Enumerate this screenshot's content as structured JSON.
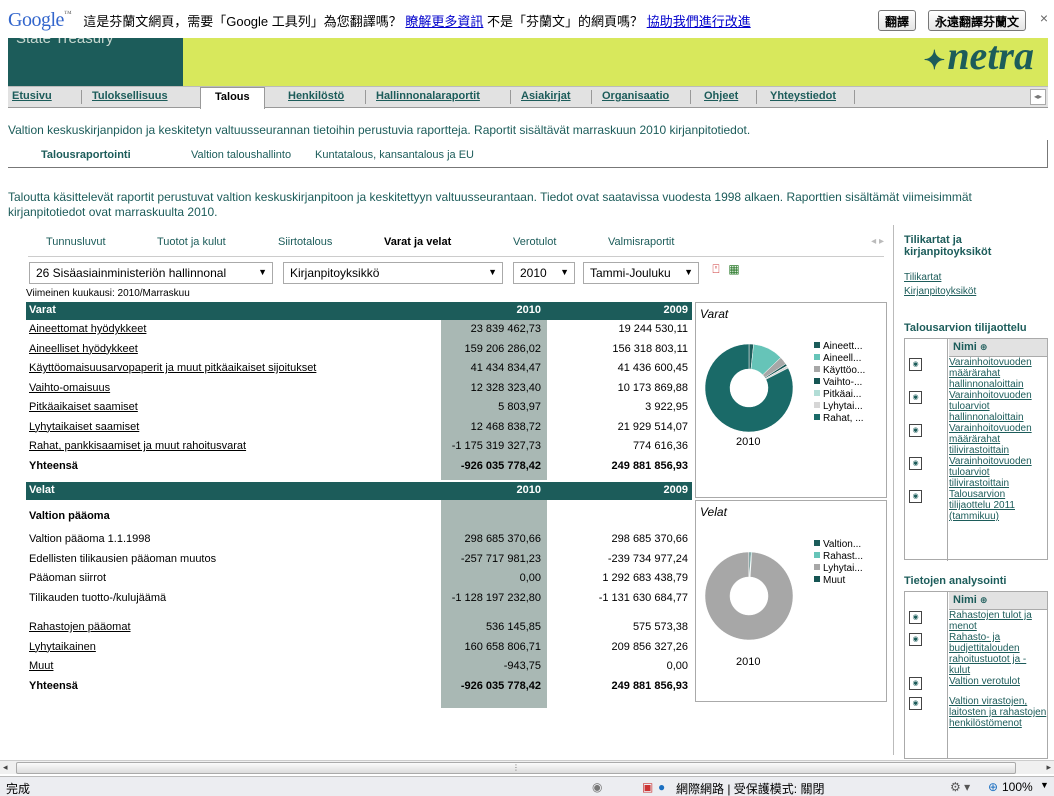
{
  "translate_bar": {
    "logo": "Google",
    "prompt": "這是芬蘭文網頁，需要「Google 工具列」為您翻譯嗎？",
    "learn_more": "瞭解更多資訊",
    "not_finnish": "不是「芬蘭文」的網頁嗎？",
    "help_improve": "協助我們進行改進",
    "translate_btn": "翻譯",
    "always_btn": "永遠翻譯芬蘭文",
    "close": "×"
  },
  "header": {
    "left_text": "State Treasury",
    "brand": "netra"
  },
  "nav": {
    "tabs": [
      "Etusivu",
      "Tuloksellisuus",
      "Talous",
      "Henkilöstö",
      "Hallinnonalaraportit",
      "Asiakirjat",
      "Organisaatio",
      "Ohjeet",
      "Yhteystiedot"
    ],
    "active": "Talous"
  },
  "intro1": "Valtion keskuskirjanpidon ja keskitetyn valtuusseurannan tietoihin perustuvia raportteja. Raportit sisältävät marraskuun 2010 kirjanpitotiedot.",
  "subnav": [
    "Talousraportointi",
    "Valtion taloushallinto",
    "Kuntatalous, kansantalous ja EU"
  ],
  "intro2": "Taloutta käsittelevät raportit perustuvat valtion keskuskirjanpitoon ja keskitettyyn valtuusseurantaan. Tiedot ovat saatavissa vuodesta 1998 alkaen. Raporttien sisältämät viimeisimmät kirjanpitotiedot ovat marraskuulta 2010.",
  "report_tabs": [
    "Tunnusluvut",
    "Tuotot ja kulut",
    "Siirtotalous",
    "Varat ja velat",
    "Verotulot",
    "Valmisraportit"
  ],
  "report_tab_active": "Varat ja velat",
  "filters": {
    "ministry": "26 Sisäasiainministeriön hallinnonal",
    "unit": "Kirjanpitoyksikkö",
    "year": "2010",
    "period": "Tammi-Jouluku"
  },
  "last_month": "Viimeinen kuukausi: 2010/Marraskuu",
  "assets": {
    "header": {
      "label": "Varat",
      "y1": "2010",
      "y2": "2009"
    },
    "rows": [
      {
        "label": "Aineettomat hyödykkeet",
        "v1": "23 839 462,73",
        "v2": "19 244 530,11",
        "link": true
      },
      {
        "label": "Aineelliset hyödykkeet",
        "v1": "159 206 286,02",
        "v2": "156 318 803,11",
        "link": true
      },
      {
        "label": "Käyttöomaisuusarvopaperit ja muut pitkäaikaiset sijoitukset",
        "v1": "41 434 834,47",
        "v2": "41 436 600,45",
        "link": true
      },
      {
        "label": "Vaihto-omaisuus",
        "v1": "12 328 323,40",
        "v2": "10 173 869,88",
        "link": true
      },
      {
        "label": "Pitkäaikaiset saamiset",
        "v1": "5 803,97",
        "v2": "3 922,95",
        "link": true
      },
      {
        "label": "Lyhytaikaiset saamiset",
        "v1": "12 468 838,72",
        "v2": "21 929 514,07",
        "link": true
      },
      {
        "label": "Rahat, pankkisaamiset ja muut rahoitusvarat",
        "v1": "-1 175 319 327,73",
        "v2": "774 616,36",
        "link": true
      }
    ],
    "total": {
      "label": "Yhteensä",
      "v1": "-926 035 778,42",
      "v2": "249 881 856,93"
    }
  },
  "liabilities": {
    "header": {
      "label": "Velat",
      "y1": "2010",
      "y2": "2009"
    },
    "section": "Valtion pääoma",
    "rows": [
      {
        "label": "Valtion pääoma 1.1.1998",
        "v1": "298 685 370,66",
        "v2": "298 685 370,66",
        "link": false
      },
      {
        "label": "Edellisten tilikausien pääoman muutos",
        "v1": "-257 717 981,23",
        "v2": "-239 734 977,24",
        "link": false
      },
      {
        "label": "Pääoman siirrot",
        "v1": "0,00",
        "v2": "1 292 683 438,79",
        "link": false
      },
      {
        "label": "Tilikauden tuotto-/kulujäämä",
        "v1": "-1 128 197 232,80",
        "v2": "-1 131 630 684,77",
        "link": false
      },
      {
        "label": "Rahastojen pääomat",
        "v1": "536 145,85",
        "v2": "575 573,38",
        "link": true
      },
      {
        "label": "Lyhytaikainen",
        "v1": "160 658 806,71",
        "v2": "209 856 327,26",
        "link": true
      },
      {
        "label": "Muut",
        "v1": "-943,75",
        "v2": "0,00",
        "link": true
      }
    ],
    "total": {
      "label": "Yhteensä",
      "v1": "-926 035 778,42",
      "v2": "249 881 856,93"
    }
  },
  "chart_data": [
    {
      "type": "pie",
      "title": "Varat",
      "subtitle": "2010",
      "categories": [
        "Aineett...",
        "Aineell...",
        "Käyttöo...",
        "Vaihto-...",
        "Pitkäai...",
        "Lyhytai...",
        "Rahat, ..."
      ],
      "values": [
        23839462.73,
        159206286.02,
        41434834.47,
        12328323.4,
        5803.97,
        12468838.72,
        1175319327.73
      ],
      "colors": [
        "#1c5c5a",
        "#66c4b8",
        "#a7a7a7",
        "#165553",
        "#b2ddd6",
        "#d6d6d6",
        "#1a6a68"
      ]
    },
    {
      "type": "pie",
      "title": "Velat",
      "subtitle": "2010",
      "categories": [
        "Valtion...",
        "Rahast...",
        "Lyhytai...",
        "Muut"
      ],
      "values": [
        1087230.0,
        536145.85,
        160658806.71,
        943.75
      ],
      "colors": [
        "#1c5c5a",
        "#66c4b8",
        "#a7a7a7",
        "#165553"
      ]
    }
  ],
  "sidebar": {
    "heading": "Tilikartat ja kirjanpitoyksiköt",
    "links": [
      "Tilikartat",
      "Kirjanpitoyksiköt"
    ],
    "box1_title": "Talousarvion tilijaottelu",
    "box1_header": "Nimi",
    "box1_items": [
      "Varainhoitovuoden määrärahat hallinnonaloittain",
      "Varainhoitovuoden tuloarviot hallinnonaloittain",
      "Varainhoitovuoden määrärahat tilivirastoittain",
      "Varainhoitovuoden tuloarviot tilivirastoittain",
      "Talousarvion tilijaottelu 2011 (tammikuu)"
    ],
    "box2_title": "Tietojen analysointi",
    "box2_header": "Nimi",
    "box2_items": [
      "Rahastojen tulot ja menot",
      "Rahasto- ja budjettitalouden rahoitustuotot ja -kulut",
      "Valtion verotulot",
      "Valtion virastojen, laitosten ja rahastojen henkilöstömenot"
    ]
  },
  "status": {
    "done": "完成",
    "zone": "網際網路 | 受保護模式: 關閉",
    "zoom": "100%"
  }
}
